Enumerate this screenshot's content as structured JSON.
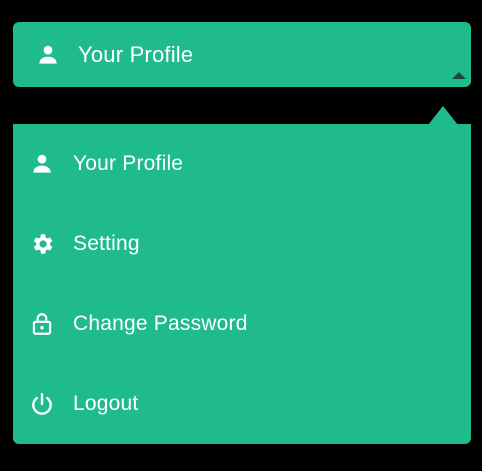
{
  "trigger": {
    "label": "Your Profile",
    "icon": "person-icon",
    "caret_icon": "caret-up-icon"
  },
  "menu": {
    "items": [
      {
        "label": "Your Profile",
        "icon": "person-icon"
      },
      {
        "label": "Setting",
        "icon": "gear-icon"
      },
      {
        "label": "Change Password",
        "icon": "unlock-icon"
      },
      {
        "label": "Logout",
        "icon": "power-icon"
      }
    ]
  },
  "colors": {
    "background": "#000000",
    "accent": "#1fbb8d",
    "text": "#ffffff",
    "caret": "#1a4a3c"
  }
}
